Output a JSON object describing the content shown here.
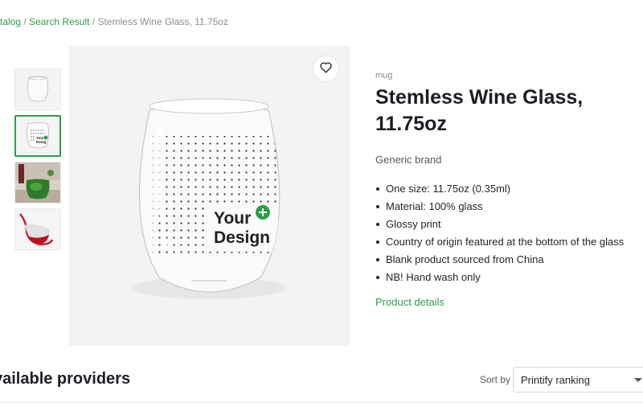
{
  "breadcrumb": {
    "items": [
      "talog",
      "Search Result"
    ],
    "separator": "/",
    "current": "Stemless Wine Glass, 11.75oz"
  },
  "gallery": {
    "thumbnails": [
      "glass-plain",
      "glass-your-design",
      "glass-with-plant",
      "glass-red-wine"
    ],
    "active_index": 1,
    "design_text_line1": "Your",
    "design_text_line2": "Design",
    "favorite_icon": "heart-icon"
  },
  "product": {
    "category": "mug",
    "title_line1": "Stemless Wine Glass,",
    "title_line2": "11.75oz",
    "brand": "Generic brand",
    "features": [
      "One size: 11.75oz (0.35ml)",
      "Material: 100% glass",
      "Glossy print",
      "Country of origin featured at the bottom of the glass",
      "Blank product sourced from China",
      "NB! Hand wash only"
    ],
    "details_link": "Product details"
  },
  "providers": {
    "title": "vailable providers",
    "sort_label": "Sort by",
    "sort_value": "Printify ranking"
  },
  "colors": {
    "accent": "#2e9c4a",
    "muted_text": "#8a8f94",
    "image_bg": "#f3f3f3"
  }
}
